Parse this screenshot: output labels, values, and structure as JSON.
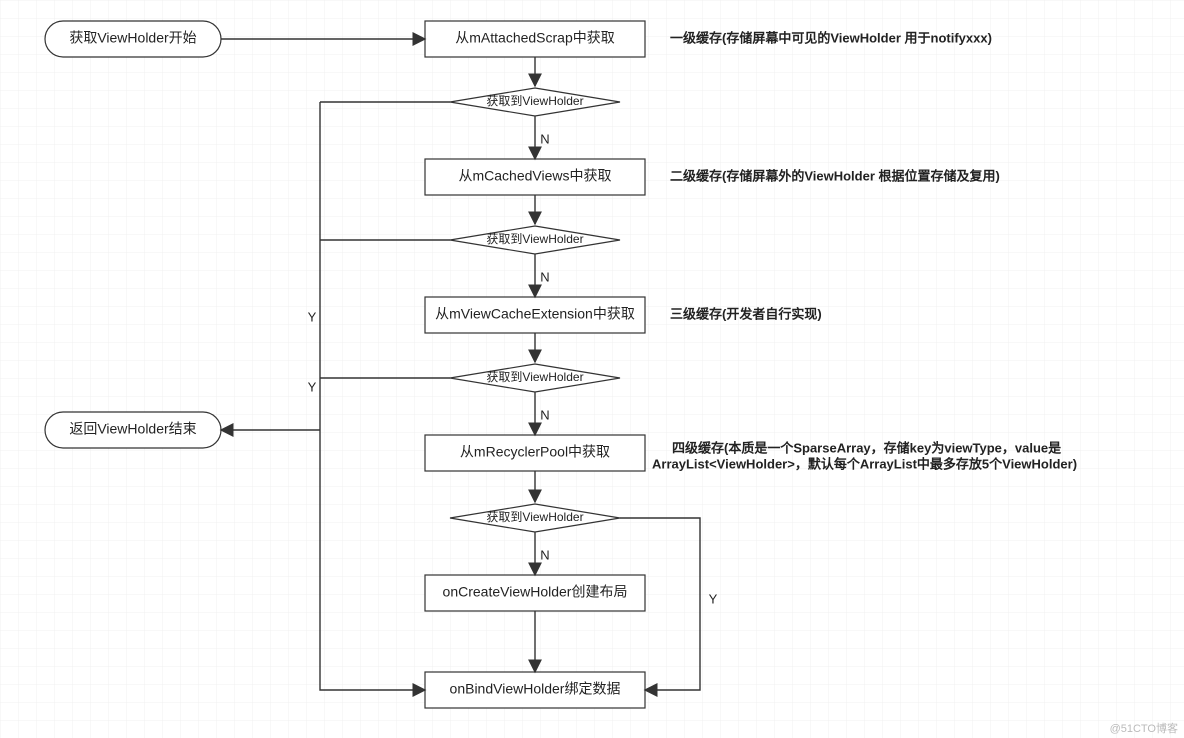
{
  "terminals": {
    "start": "获取ViewHolder开始",
    "end": "返回ViewHolder结束"
  },
  "processes": {
    "attachedScrap": "从mAttachedScrap中获取",
    "cachedViews": "从mCachedViews中获取",
    "viewCacheExt": "从mViewCacheExtension中获取",
    "recyclerPool": "从mRecyclerPool中获取",
    "onCreate": "onCreateViewHolder创建布局",
    "onBind": "onBindViewHolder绑定数据"
  },
  "decisions": {
    "d1": "获取到ViewHolder",
    "d2": "获取到ViewHolder",
    "d3": "获取到ViewHolder",
    "d4": "获取到ViewHolder"
  },
  "edgeLabels": {
    "Y": "Y",
    "N": "N"
  },
  "notes": {
    "n1": "一级缓存(存储屏幕中可见的ViewHolder 用于notifyxxx)",
    "n2": "二级缓存(存储屏幕外的ViewHolder 根据位置存储及复用)",
    "n3": "三级缓存(开发者自行实现)",
    "n4a": "四级缓存(本质是一个SparseArray，存储key为viewType，value是",
    "n4b": "ArrayList<ViewHolder>，默认每个ArrayList中最多存放5个ViewHolder)"
  },
  "watermark": "@51CTO博客"
}
